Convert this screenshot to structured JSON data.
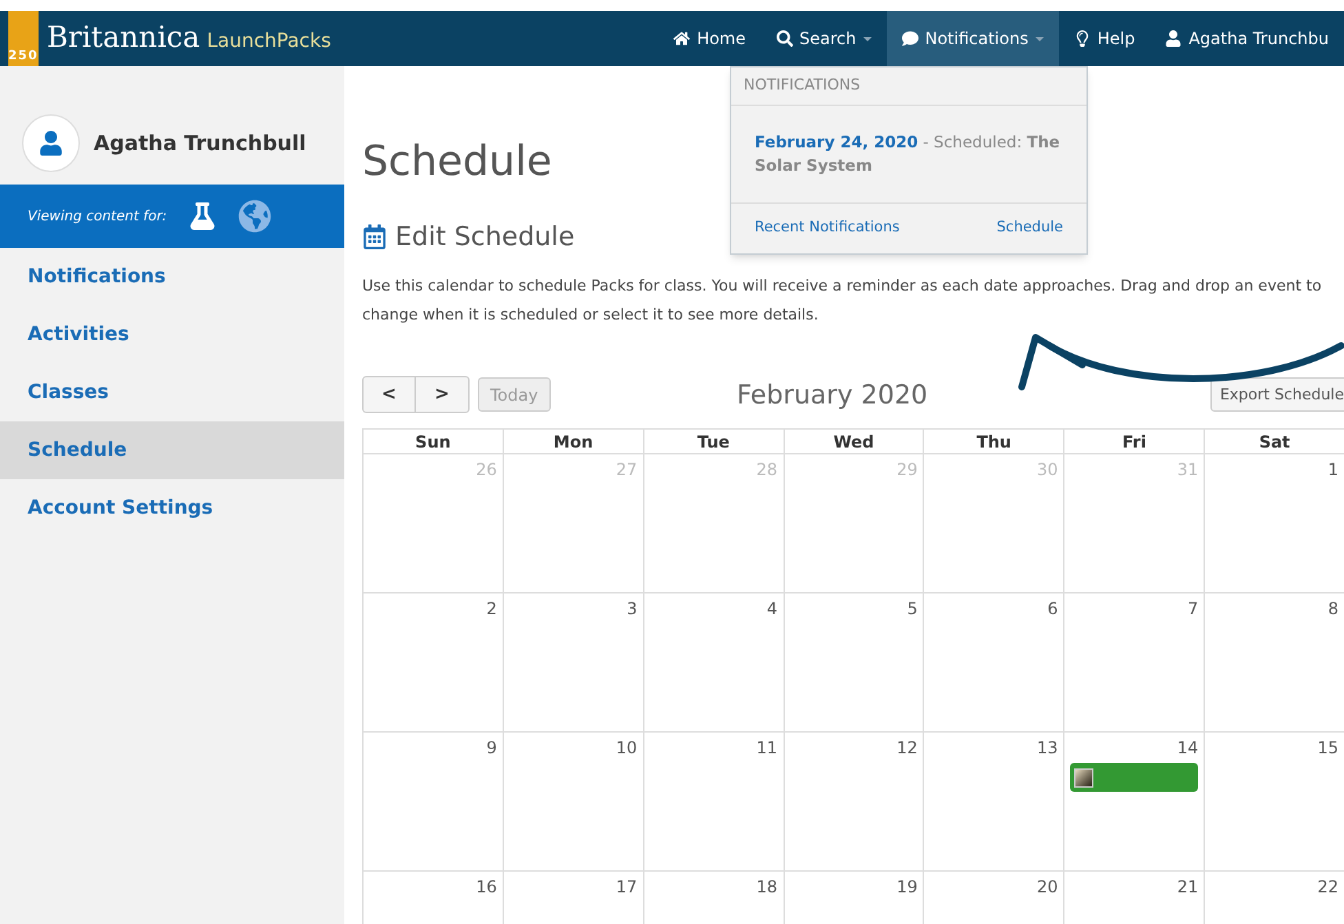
{
  "brand": {
    "badge": "250",
    "name": "Britannica",
    "product": "LaunchPacks"
  },
  "nav": [
    {
      "label": "Home",
      "dropdown": false,
      "selected": false
    },
    {
      "label": "Search",
      "dropdown": true,
      "selected": false
    },
    {
      "label": "Notifications",
      "dropdown": true,
      "selected": true
    },
    {
      "label": "Help",
      "dropdown": false,
      "selected": false
    },
    {
      "label": "Agatha Trunchbu",
      "dropdown": false,
      "selected": false
    }
  ],
  "notifications_menu": {
    "header": "NOTIFICATIONS",
    "items": [
      {
        "date": "February 24, 2020",
        "text": "- Scheduled: **The Solar System**"
      }
    ],
    "footer_left": "Recent Notifications",
    "footer_right": "Schedule"
  },
  "sidebar": {
    "user": "Agatha Trunchbull",
    "viewing_label": "Viewing content for:",
    "items": [
      {
        "label": "Notifications",
        "selected": false
      },
      {
        "label": "Activities",
        "selected": false
      },
      {
        "label": "Classes",
        "selected": false
      },
      {
        "label": "Schedule",
        "selected": true
      },
      {
        "label": "Account Settings",
        "selected": false
      }
    ]
  },
  "page_title": "Schedule",
  "section_title": "Edit Schedule",
  "description": "Use this calendar to schedule Packs for class. You will receive a reminder as each date approaches. Drag and drop an event to change when it is scheduled or select it to see more details.",
  "calendar": {
    "prev": "<",
    "next": ">",
    "today": "Today",
    "month": "February 2020",
    "export": "Export Schedule",
    "weekdays": [
      "Sun",
      "Mon",
      "Tue",
      "Wed",
      "Thu",
      "Fri",
      "Sat"
    ],
    "weeks": [
      [
        {
          "day": "26",
          "other_month": true
        },
        {
          "day": "27",
          "other_month": true
        },
        {
          "day": "28",
          "other_month": true
        },
        {
          "day": "29",
          "other_month": true
        },
        {
          "day": "30",
          "other_month": true
        },
        {
          "day": "31",
          "other_month": true
        },
        {
          "day": "1",
          "other_month": false
        }
      ],
      [
        {
          "day": "2",
          "other_month": false
        },
        {
          "day": "3",
          "other_month": false
        },
        {
          "day": "4",
          "other_month": false
        },
        {
          "day": "5",
          "other_month": false
        },
        {
          "day": "6",
          "other_month": false
        },
        {
          "day": "7",
          "other_month": false
        },
        {
          "day": "8",
          "other_month": false
        }
      ],
      [
        {
          "day": "9",
          "other_month": false
        },
        {
          "day": "10",
          "other_month": false
        },
        {
          "day": "11",
          "other_month": false
        },
        {
          "day": "12",
          "other_month": false
        },
        {
          "day": "13",
          "other_month": false
        },
        {
          "day": "14",
          "other_month": false,
          "events": [
            {
              "color": "#339933"
            }
          ]
        },
        {
          "day": "15",
          "other_month": false
        }
      ],
      [
        {
          "day": "16",
          "other_month": false
        },
        {
          "day": "17",
          "other_month": false
        },
        {
          "day": "18",
          "other_month": false
        },
        {
          "day": "19",
          "other_month": false
        },
        {
          "day": "20",
          "other_month": false
        },
        {
          "day": "21",
          "other_month": false
        },
        {
          "day": "22",
          "other_month": false
        }
      ]
    ]
  }
}
